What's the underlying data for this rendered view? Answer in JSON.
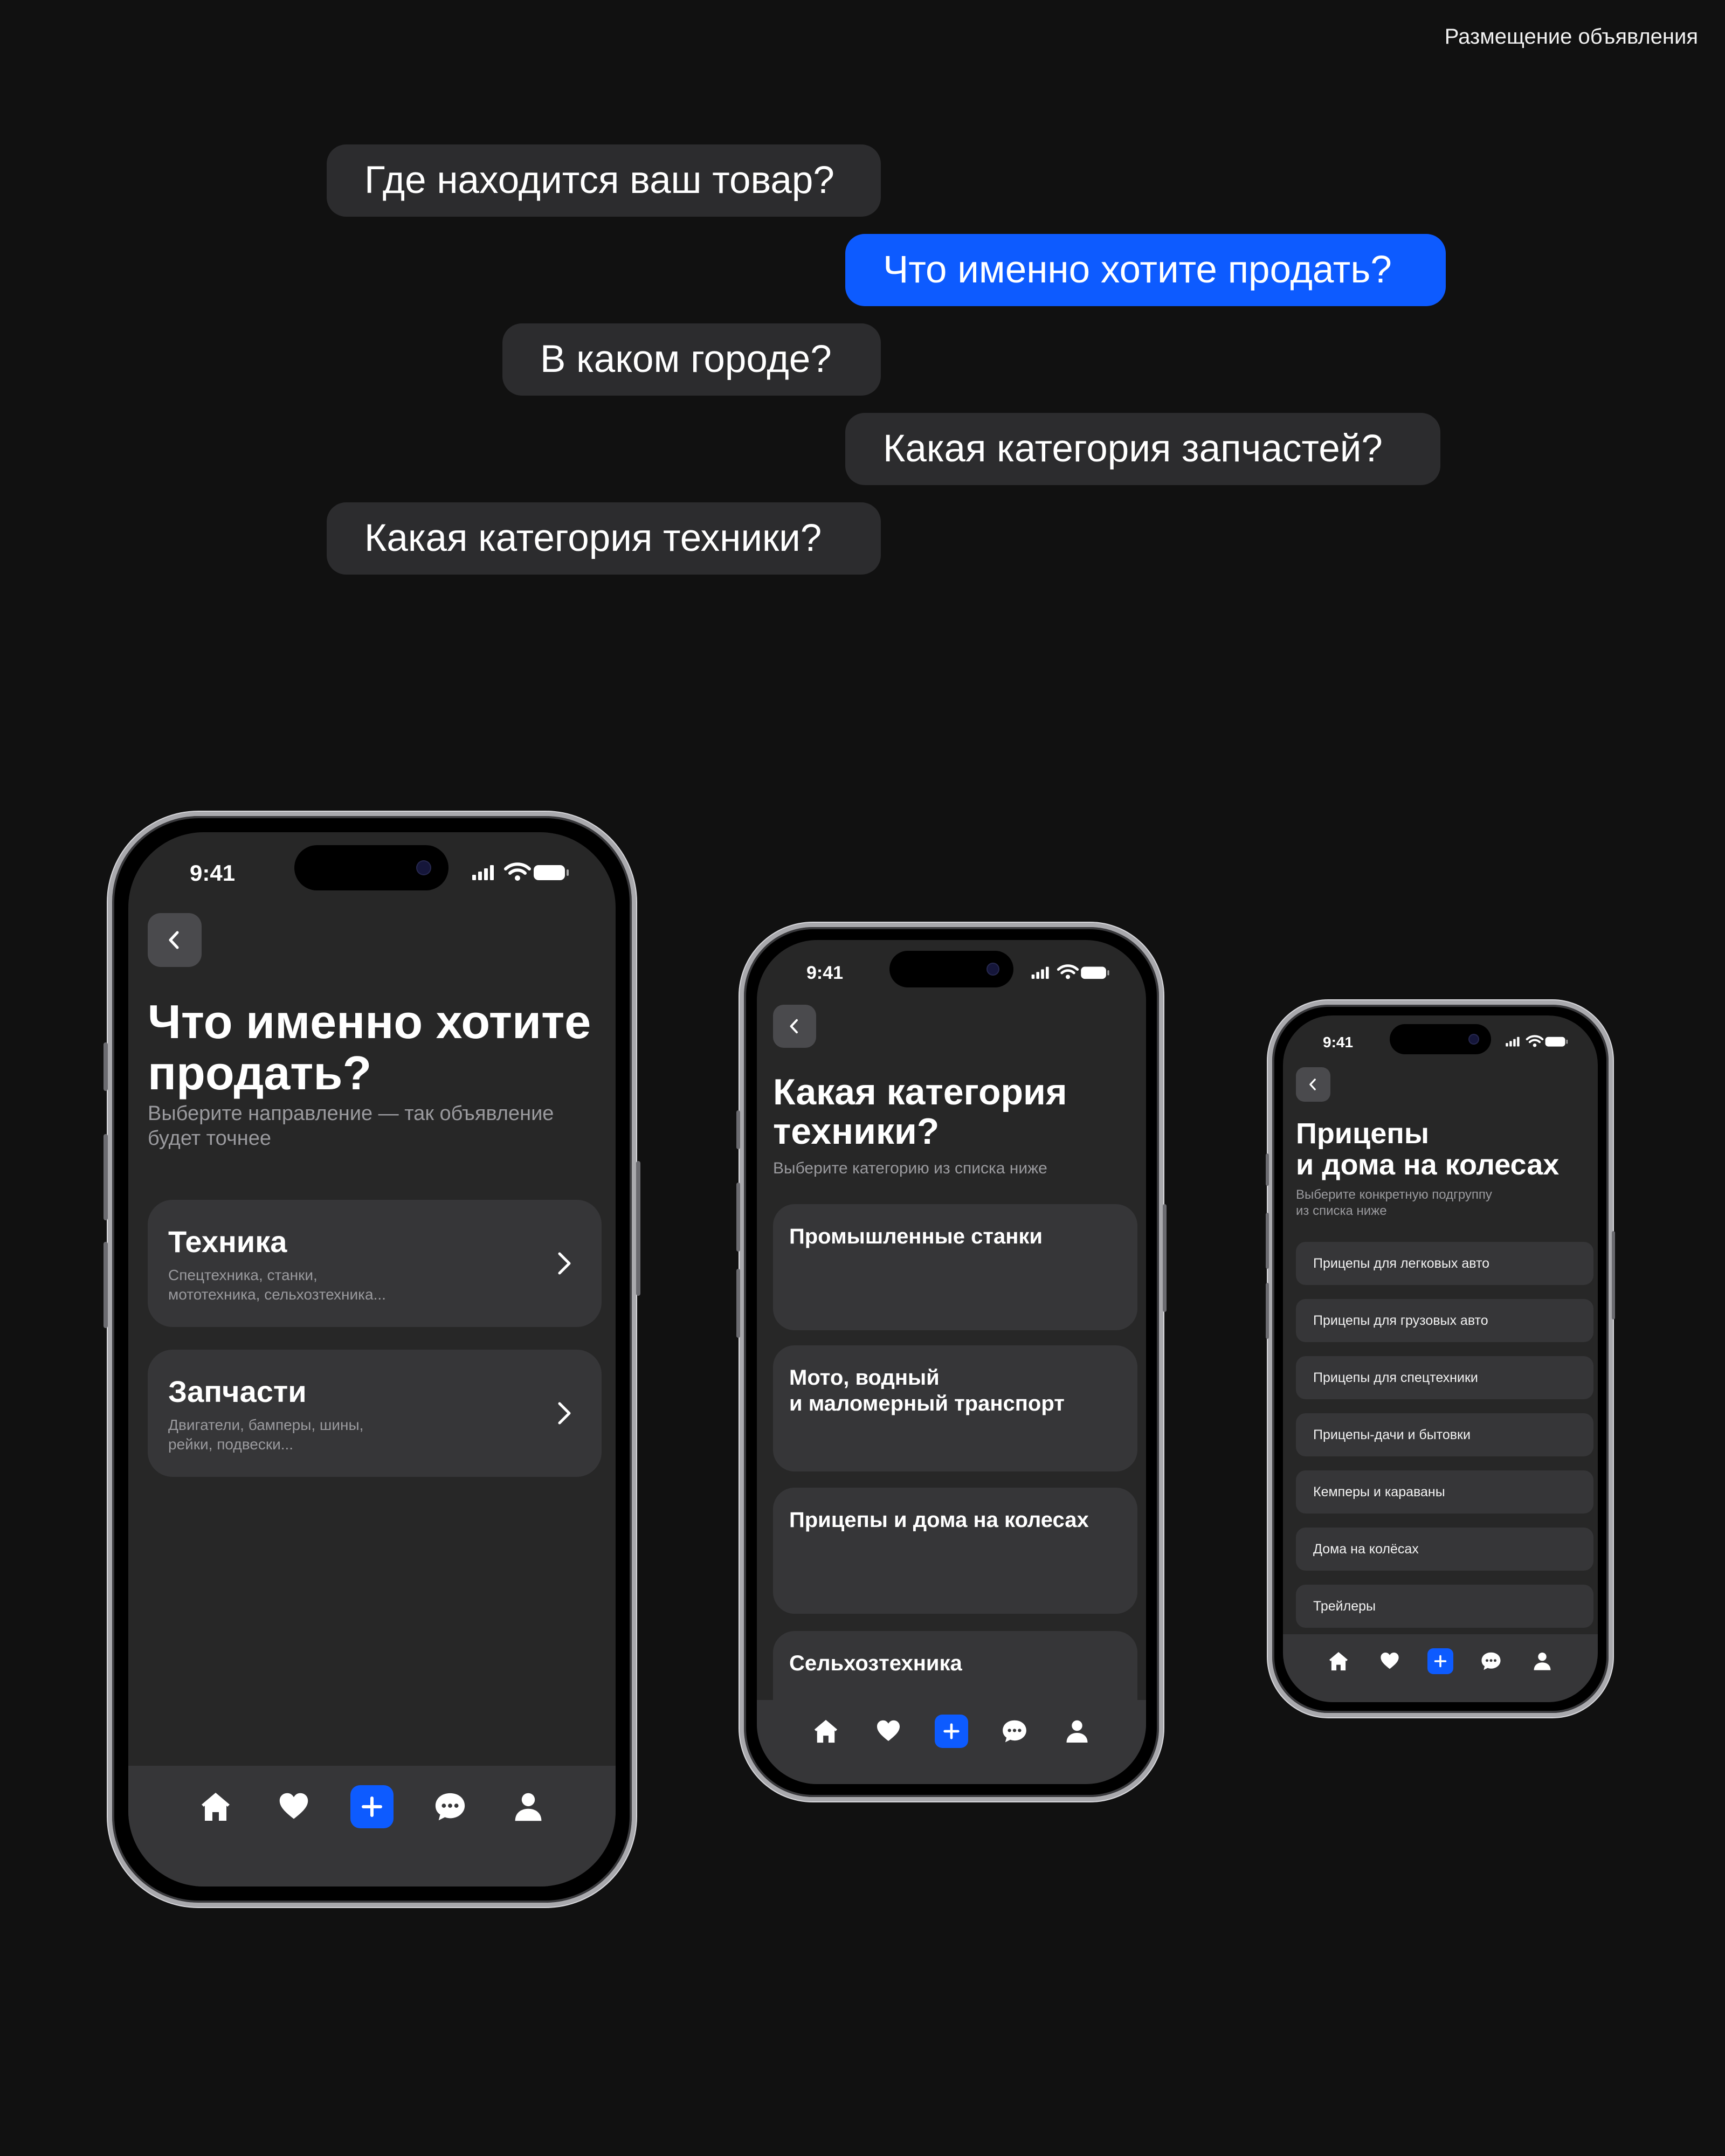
{
  "header": {
    "label": "Размещение объявления"
  },
  "bubbles": [
    {
      "text": "Где находится ваш товар?"
    },
    {
      "text": "Что именно хотите продать?"
    },
    {
      "text": "В каком городе?"
    },
    {
      "text": "Какая категория запчастей?"
    },
    {
      "text": "Какая категория техники?"
    }
  ],
  "colors": {
    "accent": "#0d5bff",
    "bubble": "#2c2c2e",
    "screen": "#272727",
    "card": "#363638"
  },
  "status": {
    "time": "9:41"
  },
  "phone1": {
    "title": "Что именно хотите продать?",
    "title_line1": "Что именно хотите",
    "title_line2": "продать?",
    "subtitle_line1": "Выберите направление — так объявление",
    "subtitle_line2": "будет точнее",
    "cards": [
      {
        "title": "Техника",
        "desc1": "Спецтехника, станки,",
        "desc2": "мототехника, сельхозтехника..."
      },
      {
        "title": "Запчасти",
        "desc1": "Двигатели, бамперы, шины,",
        "desc2": "рейки, подвески..."
      }
    ]
  },
  "phone2": {
    "title_line1": "Какая категория",
    "title_line2": "техники?",
    "subtitle": "Выберите категорию  из списка ниже",
    "cards": [
      {
        "line1": "Промышленные станки",
        "line2": ""
      },
      {
        "line1": "Мото, водный",
        "line2": "и маломерный транспорт"
      },
      {
        "line1": "Прицепы и дома на колесах",
        "line2": ""
      },
      {
        "line1": "Сельхозтехника",
        "line2": ""
      }
    ]
  },
  "phone3": {
    "title_line1": "Прицепы",
    "title_line2": "и дома на колесах",
    "subtitle_line1": "Выберите конкретную подгруппу",
    "subtitle_line2": "из списка ниже",
    "items": [
      "Прицепы для легковых авто",
      "Прицепы для грузовых авто",
      "Прицепы для спецтехники",
      "Прицепы-дачи и бытовки",
      "Кемперы и караваны",
      "Дома на колёсах",
      "Трейлеры"
    ]
  },
  "tabbar": {
    "icons": [
      "home-icon",
      "heart-icon",
      "plus-icon",
      "chat-icon",
      "profile-icon"
    ]
  }
}
